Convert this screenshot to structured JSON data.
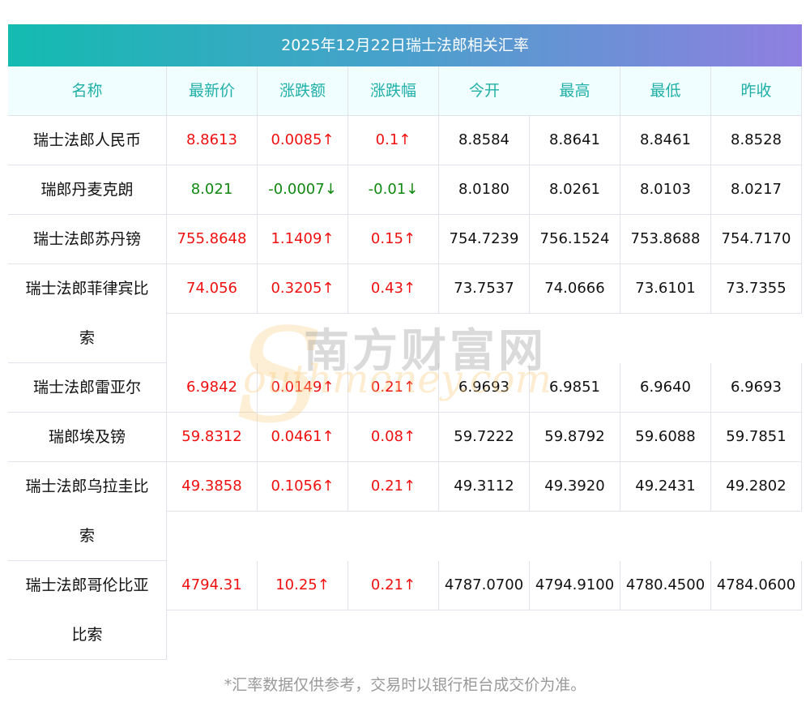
{
  "title": "2025年12月22日瑞士法郎相关汇率",
  "headers": [
    "名称",
    "最新价",
    "涨跌额",
    "涨跌幅",
    "今开",
    "最高",
    "最低",
    "昨收"
  ],
  "rows": [
    {
      "name": "瑞士法郎人民币",
      "name2": "",
      "dir": "up",
      "cells": [
        "8.8613",
        "0.0085↑",
        "0.1↑",
        "8.8584",
        "8.8641",
        "8.8461",
        "8.8528"
      ]
    },
    {
      "name": "瑞郎丹麦克朗",
      "name2": "",
      "dir": "down",
      "cells": [
        "8.021",
        "-0.0007↓",
        "-0.01↓",
        "8.0180",
        "8.0261",
        "8.0103",
        "8.0217"
      ]
    },
    {
      "name": "瑞士法郎苏丹镑",
      "name2": "",
      "dir": "up",
      "cells": [
        "755.8648",
        "1.1409↑",
        "0.15↑",
        "754.7239",
        "756.1524",
        "753.8688",
        "754.7170"
      ]
    },
    {
      "name": "瑞士法郎菲律宾比",
      "name2": "索",
      "dir": "up",
      "cells": [
        "74.056",
        "0.3205↑",
        "0.43↑",
        "73.7537",
        "74.0666",
        "73.6101",
        "73.7355"
      ]
    },
    {
      "name": "瑞士法郎雷亚尔",
      "name2": "",
      "dir": "up",
      "cells": [
        "6.9842",
        "0.0149↑",
        "0.21↑",
        "6.9693",
        "6.9851",
        "6.9640",
        "6.9693"
      ]
    },
    {
      "name": "瑞郎埃及镑",
      "name2": "",
      "dir": "up",
      "cells": [
        "59.8312",
        "0.0461↑",
        "0.08↑",
        "59.7222",
        "59.8792",
        "59.6088",
        "59.7851"
      ]
    },
    {
      "name": "瑞士法郎乌拉圭比",
      "name2": "索",
      "dir": "up",
      "cells": [
        "49.3858",
        "0.1056↑",
        "0.21↑",
        "49.3112",
        "49.3920",
        "49.2431",
        "49.2802"
      ]
    },
    {
      "name": "瑞士法郎哥伦比亚",
      "name2": "比索",
      "dir": "up",
      "cells": [
        "4794.31",
        "10.25↑",
        "0.21↑",
        "4787.0700",
        "4794.9100",
        "4780.4500",
        "4784.0600"
      ]
    }
  ],
  "footer": "*汇率数据仅供参考，交易时以银行柜台成交价为准。",
  "watermark": {
    "cn": "南方财富网",
    "en": "southmoney.com"
  },
  "colors": {
    "up": "#f01010",
    "down": "#118811",
    "header_text": "#20b0a8"
  }
}
